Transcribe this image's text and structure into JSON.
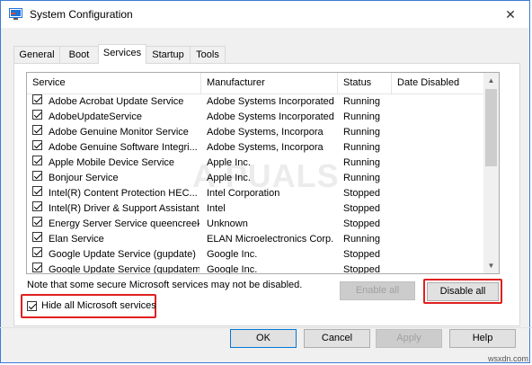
{
  "window": {
    "title": "System Configuration"
  },
  "tabs": [
    "General",
    "Boot",
    "Services",
    "Startup",
    "Tools"
  ],
  "active_tab": "Services",
  "list": {
    "columns": [
      "Service",
      "Manufacturer",
      "Status",
      "Date Disabled"
    ],
    "rows": [
      {
        "service": "Adobe Acrobat Update Service",
        "manufacturer": "Adobe Systems Incorporated",
        "status": "Running",
        "date": "",
        "checked": true
      },
      {
        "service": "AdobeUpdateService",
        "manufacturer": "Adobe Systems Incorporated",
        "status": "Running",
        "date": "",
        "checked": true
      },
      {
        "service": "Adobe Genuine Monitor Service",
        "manufacturer": "Adobe Systems, Incorpora",
        "status": "Running",
        "date": "",
        "checked": true
      },
      {
        "service": "Adobe Genuine Software Integri...",
        "manufacturer": "Adobe Systems, Incorpora",
        "status": "Running",
        "date": "",
        "checked": true
      },
      {
        "service": "Apple Mobile Device Service",
        "manufacturer": "Apple Inc.",
        "status": "Running",
        "date": "",
        "checked": true
      },
      {
        "service": "Bonjour Service",
        "manufacturer": "Apple Inc.",
        "status": "Running",
        "date": "",
        "checked": true
      },
      {
        "service": "Intel(R) Content Protection HEC...",
        "manufacturer": "Intel Corporation",
        "status": "Stopped",
        "date": "",
        "checked": true
      },
      {
        "service": "Intel(R) Driver & Support Assistant",
        "manufacturer": "Intel",
        "status": "Stopped",
        "date": "",
        "checked": true
      },
      {
        "service": "Energy Server Service queencreek",
        "manufacturer": "Unknown",
        "status": "Stopped",
        "date": "",
        "checked": true
      },
      {
        "service": "Elan Service",
        "manufacturer": "ELAN Microelectronics Corp.",
        "status": "Running",
        "date": "",
        "checked": true
      },
      {
        "service": "Google Update Service (gupdate)",
        "manufacturer": "Google Inc.",
        "status": "Stopped",
        "date": "",
        "checked": true
      },
      {
        "service": "Google Update Service (gupdatem)",
        "manufacturer": "Google Inc.",
        "status": "Stopped",
        "date": "",
        "checked": true
      }
    ]
  },
  "note": "Note that some secure Microsoft services may not be disabled.",
  "buttons": {
    "enable_all": "Enable all",
    "disable_all": "Disable all",
    "ok": "OK",
    "cancel": "Cancel",
    "apply": "Apply",
    "help": "Help"
  },
  "hide_ms": {
    "label": "Hide all Microsoft services",
    "checked": true
  },
  "watermark": "A PUALS",
  "site": "wsxdn.com",
  "colors": {
    "highlight": "#e02020",
    "accent": "#0078d7",
    "title_icon": "#1e73d6"
  },
  "icons": {
    "title": "msconfig-icon",
    "close": "close-icon",
    "scroll_up": "chevron-up-icon",
    "scroll_down": "chevron-down-icon"
  }
}
